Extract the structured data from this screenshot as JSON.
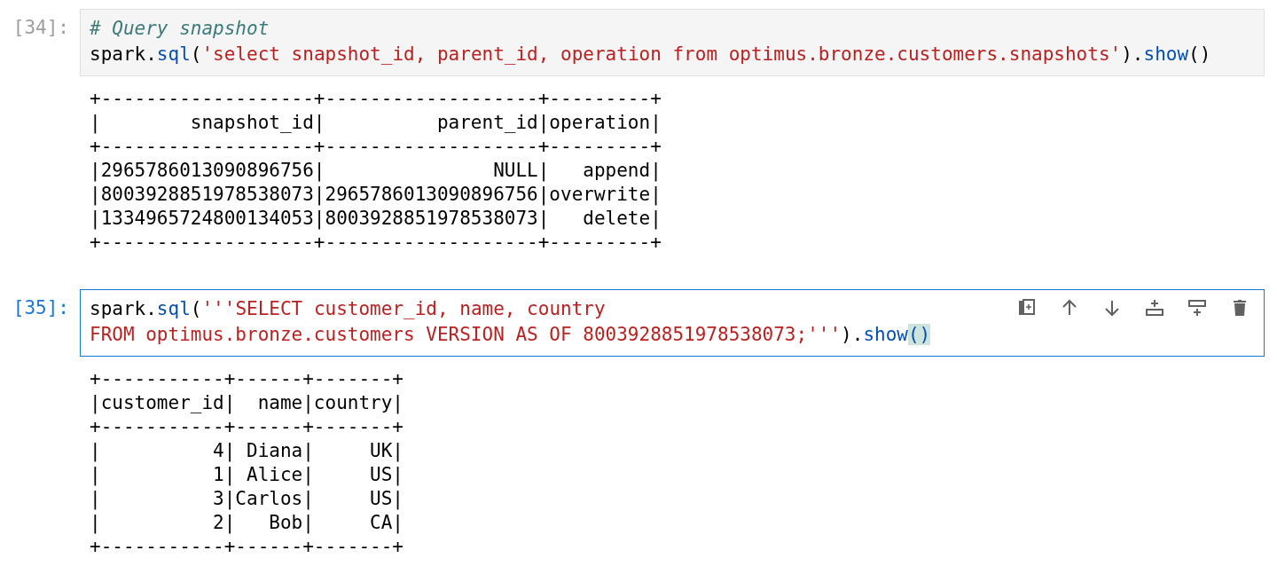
{
  "cells": [
    {
      "prompt": "[34]:",
      "selected": false,
      "lines": [
        [
          {
            "kind": "comment",
            "text": "# Query snapshot"
          }
        ],
        [
          {
            "kind": "plain",
            "text": "spark."
          },
          {
            "kind": "builtin",
            "text": "sql"
          },
          {
            "kind": "plain",
            "text": "("
          },
          {
            "kind": "string",
            "text": "'select snapshot_id, parent_id, operation from optimus.bronze.customers.snapshots'"
          },
          {
            "kind": "plain",
            "text": ")."
          },
          {
            "kind": "builtin",
            "text": "show"
          },
          {
            "kind": "plain",
            "text": "()"
          }
        ]
      ],
      "output": [
        "+-------------------+-------------------+---------+",
        "|        snapshot_id|          parent_id|operation|",
        "+-------------------+-------------------+---------+",
        "|2965786013090896756|               NULL|   append|",
        "|8003928851978538073|2965786013090896756|overwrite|",
        "|1334965724800134053|8003928851978538073|   delete|",
        "+-------------------+-------------------+---------+"
      ]
    },
    {
      "prompt": "[35]:",
      "selected": true,
      "lines": [
        [
          {
            "kind": "plain",
            "text": "spark."
          },
          {
            "kind": "builtin",
            "text": "sql"
          },
          {
            "kind": "plain",
            "text": "("
          },
          {
            "kind": "string",
            "text": "'''SELECT customer_id, name, country"
          }
        ],
        [
          {
            "kind": "string",
            "text": "FROM optimus.bronze.customers VERSION AS OF 8003928851978538073;'''"
          },
          {
            "kind": "plain",
            "text": ")."
          },
          {
            "kind": "builtin",
            "text": "show"
          },
          {
            "kind": "matched-bracket",
            "text": "()"
          }
        ]
      ],
      "output": [
        "+-----------+------+-------+",
        "|customer_id|  name|country|",
        "+-----------+------+-------+",
        "|          4| Diana|     UK|",
        "|          1| Alice|     US|",
        "|          3|Carlos|     US|",
        "|          2|   Bob|     CA|",
        "+-----------+------+-------+"
      ]
    }
  ]
}
